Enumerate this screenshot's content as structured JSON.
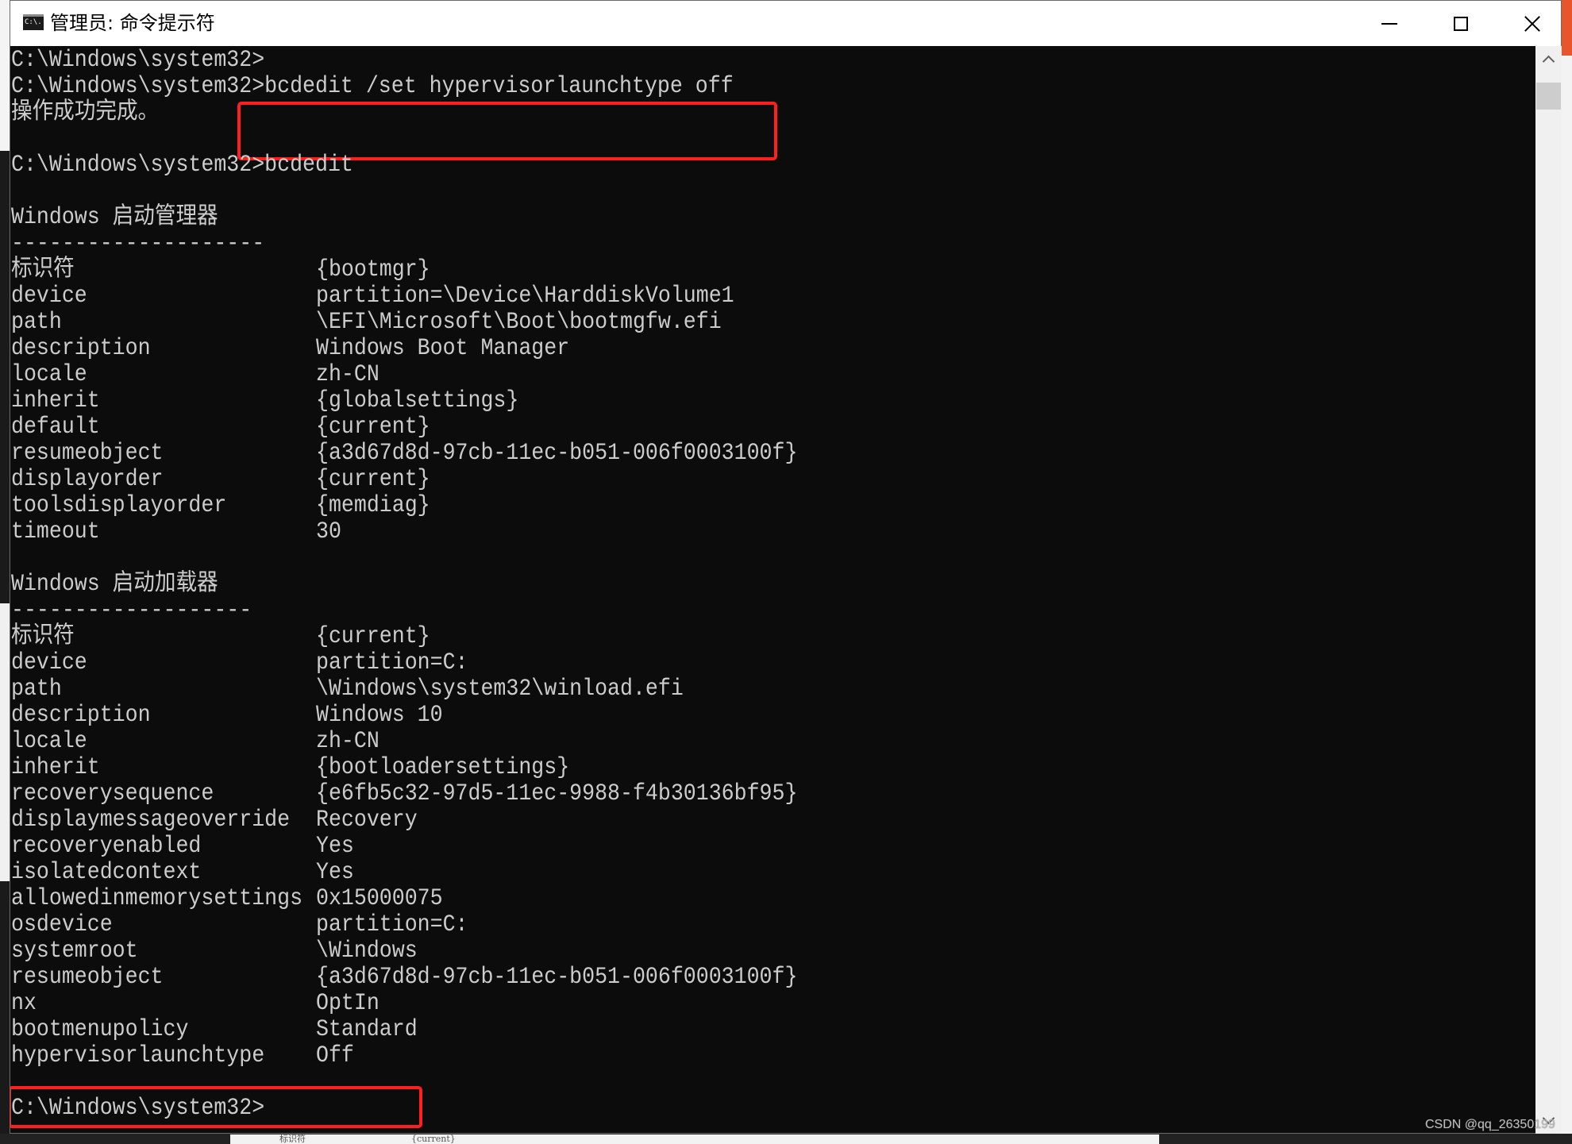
{
  "window": {
    "title": "管理员: 命令提示符",
    "icon": "cmd-icon",
    "icon_text": "C:\\.",
    "controls": [
      "minimize-icon",
      "maximize-icon",
      "close-icon"
    ]
  },
  "console": {
    "prompt": "C:\\Windows\\system32>",
    "lines": [
      {
        "text": "C:\\Windows\\system32>"
      },
      {
        "text": "C:\\Windows\\system32>bcdedit /set hypervisorlaunchtype off"
      },
      {
        "text": "操作成功完成。"
      },
      {
        "text": ""
      },
      {
        "text": "C:\\Windows\\system32>bcdedit"
      },
      {
        "text": ""
      },
      {
        "text": "Windows 启动管理器"
      },
      {
        "text": "--------------------"
      },
      {
        "key": "标识符",
        "value": "{bootmgr}"
      },
      {
        "key": "device",
        "value": "partition=\\Device\\HarddiskVolume1"
      },
      {
        "key": "path",
        "value": "\\EFI\\Microsoft\\Boot\\bootmgfw.efi"
      },
      {
        "key": "description",
        "value": "Windows Boot Manager"
      },
      {
        "key": "locale",
        "value": "zh-CN"
      },
      {
        "key": "inherit",
        "value": "{globalsettings}"
      },
      {
        "key": "default",
        "value": "{current}"
      },
      {
        "key": "resumeobject",
        "value": "{a3d67d8d-97cb-11ec-b051-006f0003100f}"
      },
      {
        "key": "displayorder",
        "value": "{current}"
      },
      {
        "key": "toolsdisplayorder",
        "value": "{memdiag}"
      },
      {
        "key": "timeout",
        "value": "30"
      },
      {
        "text": ""
      },
      {
        "text": "Windows 启动加载器"
      },
      {
        "text": "-------------------"
      },
      {
        "key": "标识符",
        "value": "{current}"
      },
      {
        "key": "device",
        "value": "partition=C:"
      },
      {
        "key": "path",
        "value": "\\Windows\\system32\\winload.efi"
      },
      {
        "key": "description",
        "value": "Windows 10"
      },
      {
        "key": "locale",
        "value": "zh-CN"
      },
      {
        "key": "inherit",
        "value": "{bootloadersettings}"
      },
      {
        "key": "recoverysequence",
        "value": "{e6fb5c32-97d5-11ec-9988-f4b30136bf95}"
      },
      {
        "key": "displaymessageoverride",
        "value": "Recovery"
      },
      {
        "key": "recoveryenabled",
        "value": "Yes"
      },
      {
        "key": "isolatedcontext",
        "value": "Yes"
      },
      {
        "key": "allowedinmemorysettings",
        "value": "0x15000075"
      },
      {
        "key": "osdevice",
        "value": "partition=C:"
      },
      {
        "key": "systemroot",
        "value": "\\Windows"
      },
      {
        "key": "resumeobject",
        "value": "{a3d67d8d-97cb-11ec-b051-006f0003100f}"
      },
      {
        "key": "nx",
        "value": "OptIn"
      },
      {
        "key": "bootmenupolicy",
        "value": "Standard"
      },
      {
        "key": "hypervisorlaunchtype",
        "value": "Off"
      },
      {
        "text": ""
      },
      {
        "text": "C:\\Windows\\system32>"
      }
    ]
  },
  "annotations": {
    "highlight_color": "#ff1f1f",
    "highlighted": [
      "bcdedit /set hypervisorlaunchtype off",
      "hypervisorlaunchtype Off"
    ]
  },
  "colors": {
    "console_bg": "#0c0c0c",
    "console_fg": "#cccccc",
    "titlebar_bg": "#ffffff"
  },
  "background": {
    "bottom_panel_key": "标识符",
    "bottom_panel_value": "{current}"
  },
  "watermark": "CSDN @qq_26350199"
}
